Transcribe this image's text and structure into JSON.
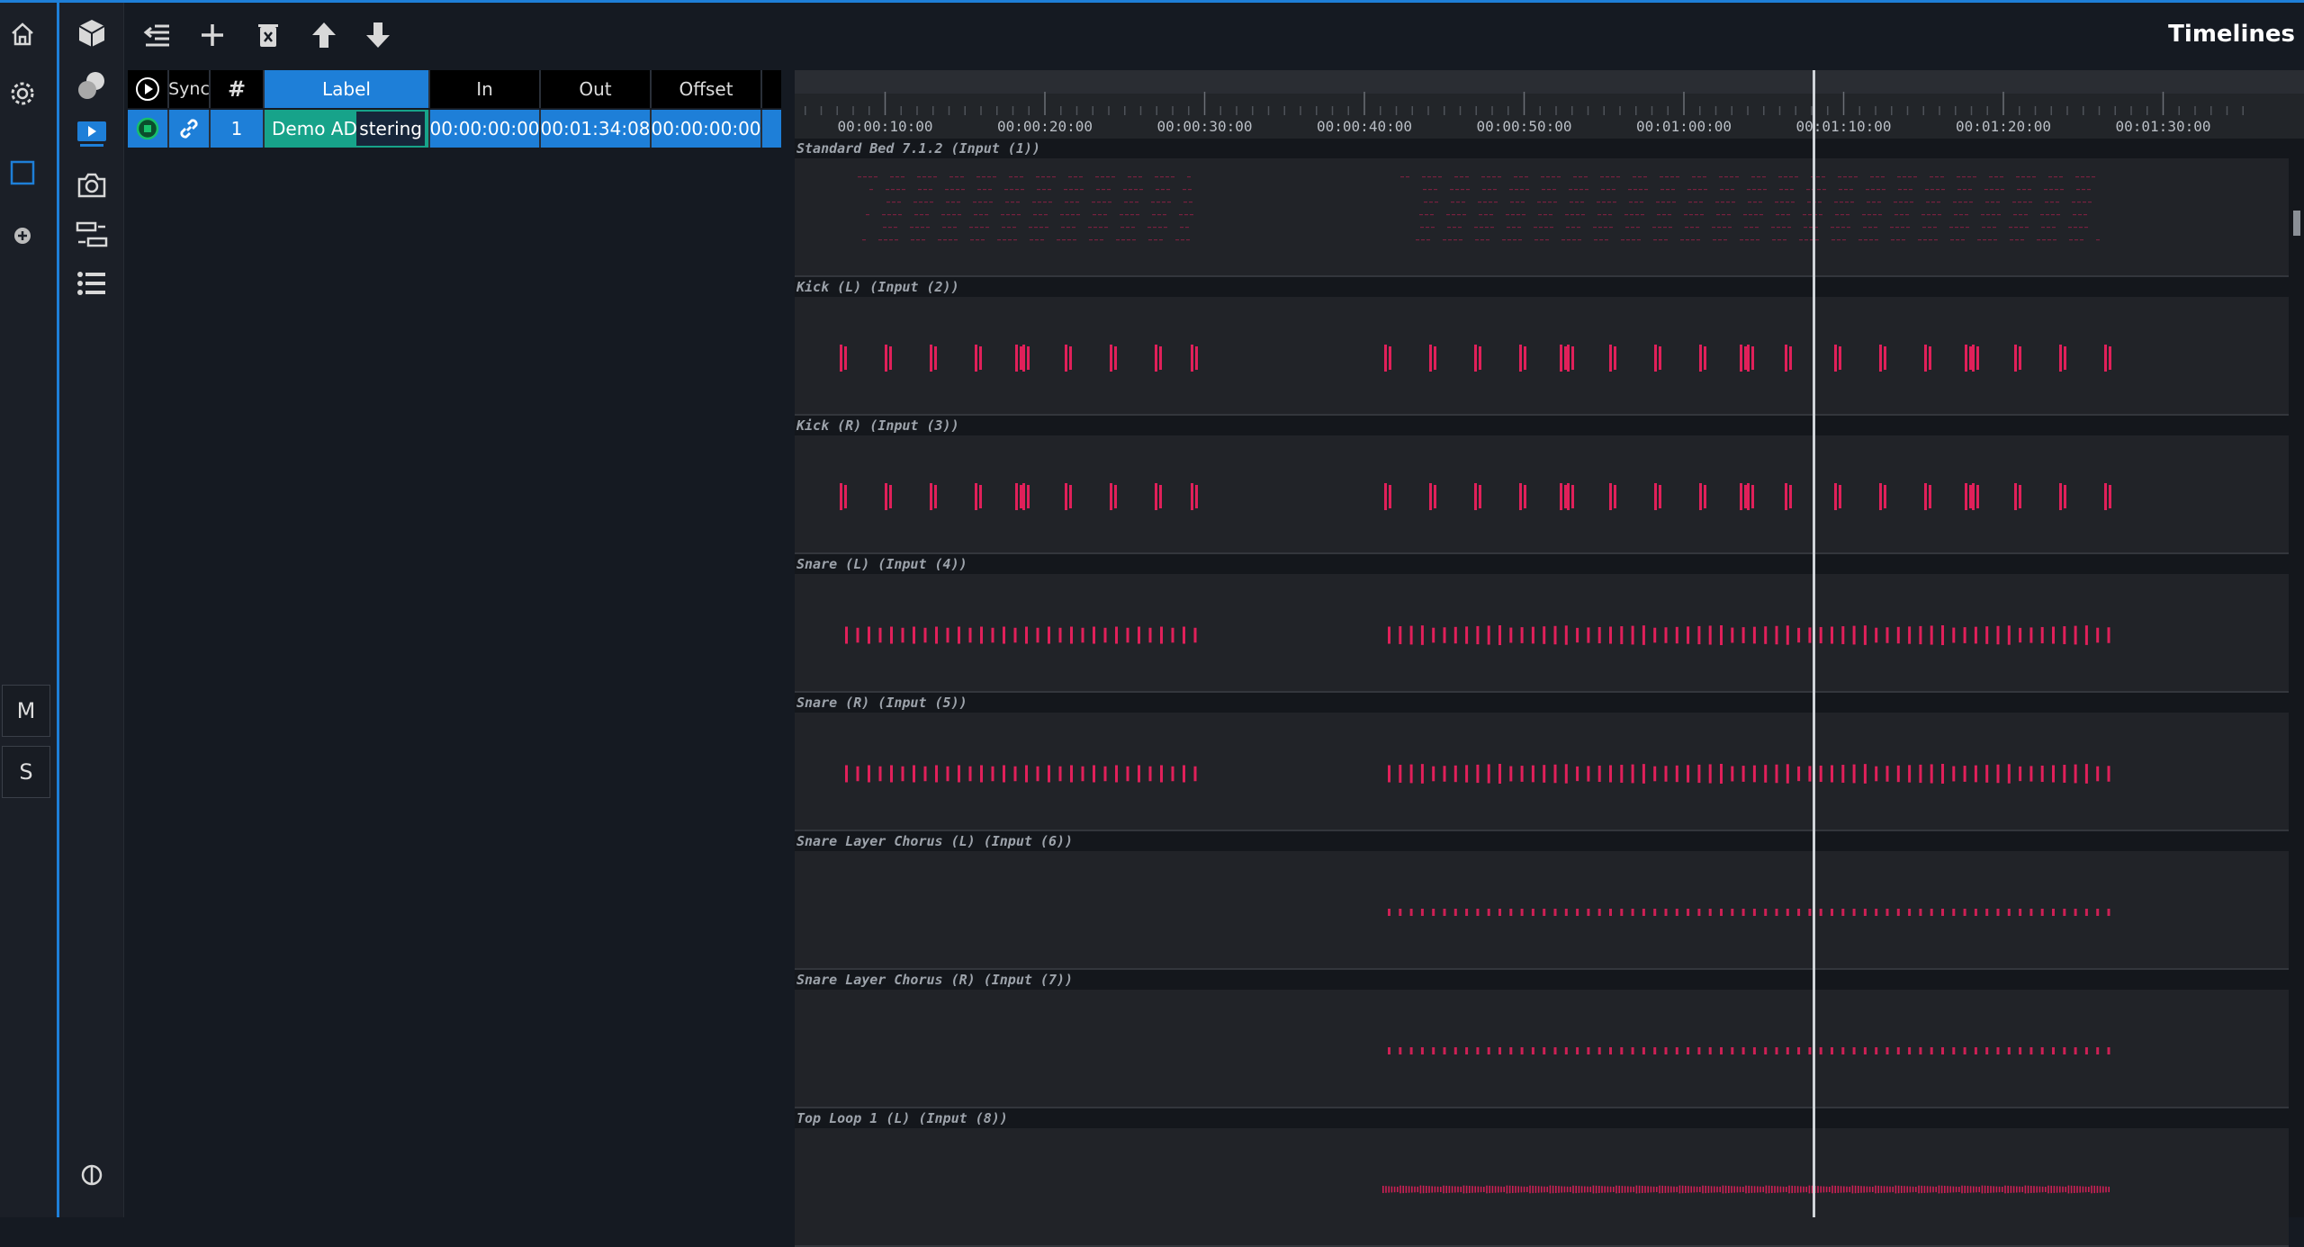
{
  "app": {
    "title": "Timelines"
  },
  "rail": {
    "mute_label": "M",
    "solo_label": "S"
  },
  "table": {
    "headers": {
      "play": "",
      "sync": "Sync",
      "index": "#",
      "label": "Label",
      "in": "In",
      "out": "Out",
      "offset": "Offset"
    },
    "rows": [
      {
        "index": "1",
        "label": "Demo AD...",
        "label_tail": "stering",
        "in": "00:00:00:00",
        "out": "00:01:34:08",
        "offset": "00:00:00:00"
      }
    ]
  },
  "timeline": {
    "time_labels": [
      "00:00:10:00",
      "00:00:20:00",
      "00:00:30:00",
      "00:00:40:00",
      "00:00:50:00",
      "00:01:00:00",
      "00:01:10:00",
      "00:01:20:00",
      "00:01:30:00"
    ],
    "playhead_time": "00:01:05:00",
    "tracks": [
      {
        "name": "Standard Bed 7.1.2 (Input (1))",
        "style": "bed"
      },
      {
        "name": "Kick (L) (Input (2))",
        "style": "kick"
      },
      {
        "name": "Kick (R) (Input (3))",
        "style": "kick"
      },
      {
        "name": "Snare (L) (Input (4))",
        "style": "snare"
      },
      {
        "name": "Snare (R) (Input (5))",
        "style": "snare"
      },
      {
        "name": "Snare Layer Chorus (L) (Input (6))",
        "style": "chorus"
      },
      {
        "name": "Snare Layer Chorus (R) (Input (7))",
        "style": "chorus"
      },
      {
        "name": "Top Loop 1 (L) (Input (8))",
        "style": "loop"
      }
    ]
  },
  "colors": {
    "accent": "#1e7fd8",
    "waveform": "#e0205a",
    "label_cell": "#17a38a"
  }
}
